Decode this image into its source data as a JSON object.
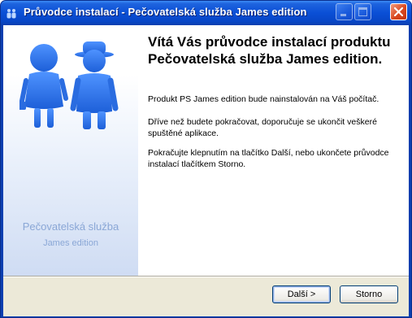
{
  "window": {
    "title": "Průvodce instalací - Pečovatelská služba James edition"
  },
  "sidebar": {
    "brand_line1": "Pečovatelská služba",
    "brand_line2": "James edition"
  },
  "content": {
    "heading": "Vítá Vás průvodce instalací produktu Pečovatelská služba James edition.",
    "paragraph1": "Produkt PS James edition bude nainstalován na Váš počítač.",
    "paragraph2": "Dříve než budete pokračovat, doporučuje se ukončit veškeré spuštěné aplikace.",
    "paragraph3": "Pokračujte klepnutím na tlačítko Další, nebo ukončete průvodce instalací tlačítkem Storno."
  },
  "buttons": {
    "next": "Další >",
    "cancel": "Storno"
  },
  "icons": {
    "app": "people-icon",
    "minimize": "minimize-icon",
    "maximize": "maximize-icon",
    "close": "close-icon"
  },
  "colors": {
    "titlebar": "#0a4fd6",
    "people": "#2a6ce0",
    "brand_text": "#8aa7d6",
    "panel_bg": "#ece9d8"
  }
}
